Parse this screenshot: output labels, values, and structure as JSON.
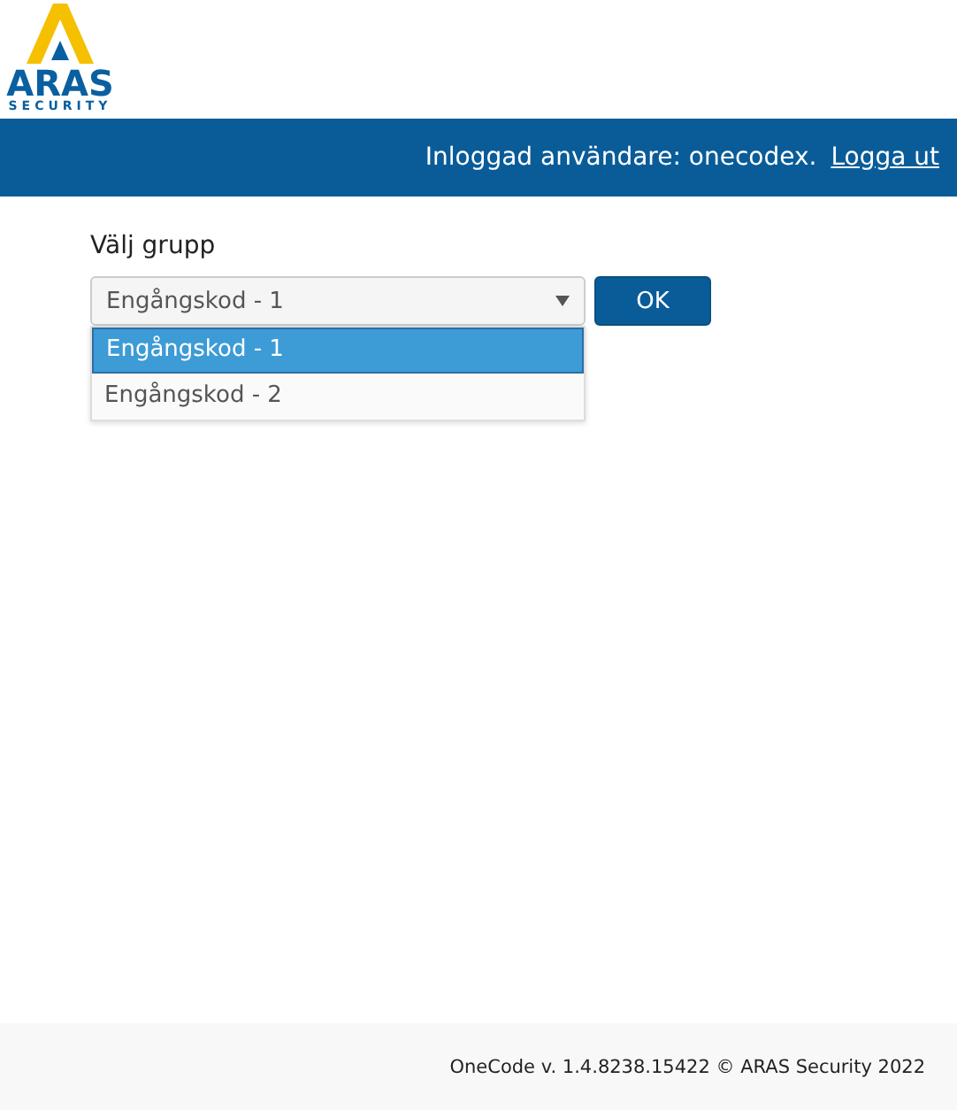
{
  "logo": {
    "name": "ARAS",
    "tagline": "SECURITY"
  },
  "nav": {
    "user_text": "Inloggad användare: onecodex.",
    "logout": "Logga ut"
  },
  "group": {
    "label": "Välj grupp",
    "value": "Engångskod - 1",
    "expanded": true,
    "ok": "OK",
    "options": [
      {
        "label": "Engångskod - 1",
        "selected": true
      },
      {
        "label": "Engångskod - 2",
        "selected": false
      }
    ]
  },
  "footer": "OneCode v. 1.4.8238.15422 © ARAS Security 2022"
}
